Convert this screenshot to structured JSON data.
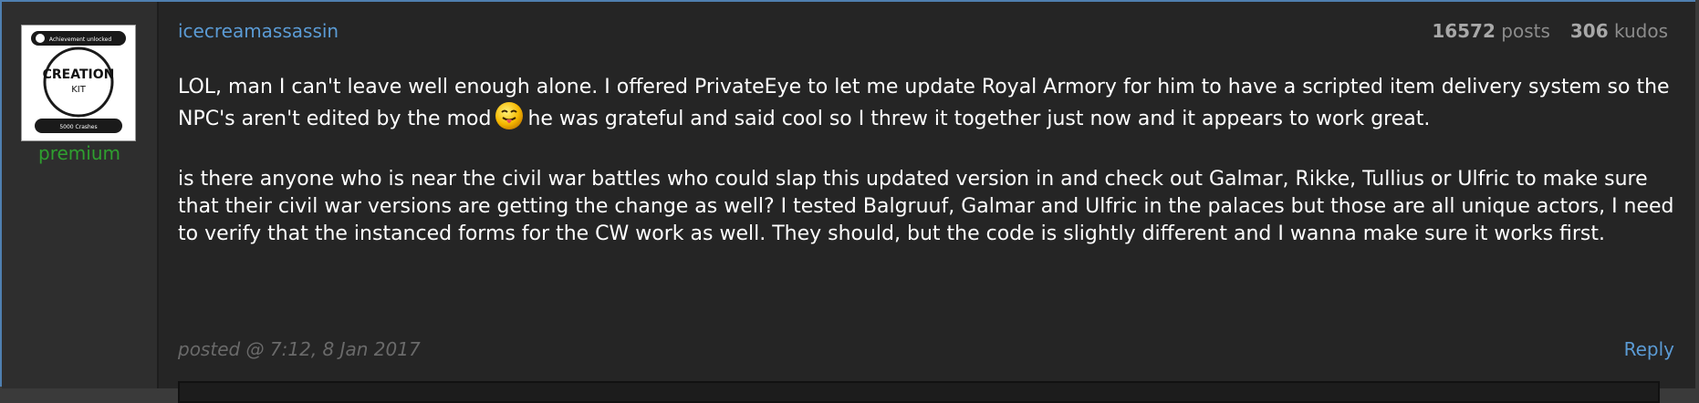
{
  "post": {
    "author": "icecreamassassin",
    "member_level": "premium",
    "posts_count": "16572",
    "posts_label": "posts",
    "kudos_count": "306",
    "kudos_label": "kudos",
    "avatar": {
      "badge_top": "Achievement unlocked",
      "logo_line1": "CREATION",
      "logo_line2": "KIT",
      "badge_bottom": "5000 Crashes"
    },
    "body_p1_before_emoji": "LOL, man I can't leave well enough alone. I offered PrivateEye to let me update Royal Armory for him to have a scripted item delivery system so the NPC's aren't edited by the mod",
    "body_p1_after_emoji": "he was grateful and said cool so I threw it together just now and it appears to work great.",
    "body_p2": "is there anyone who is near the civil war battles who could slap this updated version in and check out Galmar, Rikke, Tullius or Ulfric to make sure that their civil war versions are getting the change as well? I tested Balgruuf, Galmar and Ulfric in the palaces but those are all unique actors, I need to verify that the instanced forms for the CW work as well. They should, but the code is slightly different and I wanna make sure it works first.",
    "posted": "posted @ 7:12, 8 Jan 2017",
    "reply_label": "Reply"
  },
  "colors": {
    "link": "#5b9bd5",
    "premium": "#2f9f2f",
    "frame_border": "#4f7fb0"
  }
}
